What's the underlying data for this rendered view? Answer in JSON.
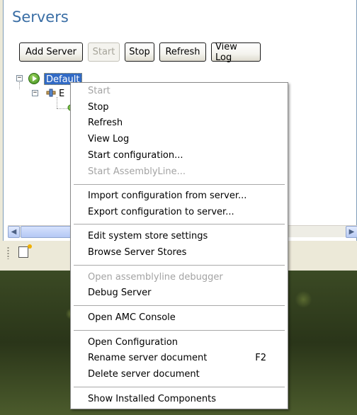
{
  "panel": {
    "title": "Servers",
    "toolbar": {
      "add_server": "Add Server",
      "start": "Start",
      "stop": "Stop",
      "refresh": "Refresh",
      "view_log": "View Log"
    },
    "tree": {
      "root_label": "Default",
      "child_label": "E",
      "root_expander": "−",
      "child_expander": "−"
    }
  },
  "context_menu": {
    "groups": [
      {
        "items": [
          {
            "label": "Start",
            "disabled": true
          },
          {
            "label": "Stop",
            "disabled": false
          },
          {
            "label": "Refresh",
            "disabled": false
          },
          {
            "label": "View Log",
            "disabled": false
          },
          {
            "label": "Start configuration...",
            "disabled": false
          },
          {
            "label": "Start AssemblyLine...",
            "disabled": true
          }
        ]
      },
      {
        "items": [
          {
            "label": "Import configuration from server...",
            "disabled": false
          },
          {
            "label": "Export configuration to server...",
            "disabled": false
          }
        ]
      },
      {
        "items": [
          {
            "label": "Edit system store settings",
            "disabled": false
          },
          {
            "label": "Browse Server Stores",
            "disabled": false
          }
        ]
      },
      {
        "items": [
          {
            "label": "Open assemblyline debugger",
            "disabled": true
          },
          {
            "label": "Debug Server",
            "disabled": false
          }
        ]
      },
      {
        "items": [
          {
            "label": "Open AMC Console",
            "disabled": false
          }
        ]
      },
      {
        "items": [
          {
            "label": "Open Configuration",
            "disabled": false
          },
          {
            "label": "Rename server document",
            "disabled": false,
            "shortcut": "F2"
          },
          {
            "label": "Delete server document",
            "disabled": false
          }
        ]
      },
      {
        "items": [
          {
            "label": "Show Installed Components",
            "disabled": false
          }
        ]
      }
    ]
  },
  "colors": {
    "title": "#3a6ea5",
    "selection": "#316ac5",
    "disabled_text": "#a3a3a3"
  },
  "icons": {
    "server_status": "play-circle-icon",
    "child_node": "connector-icon",
    "status_bar": "new-item-icon"
  }
}
